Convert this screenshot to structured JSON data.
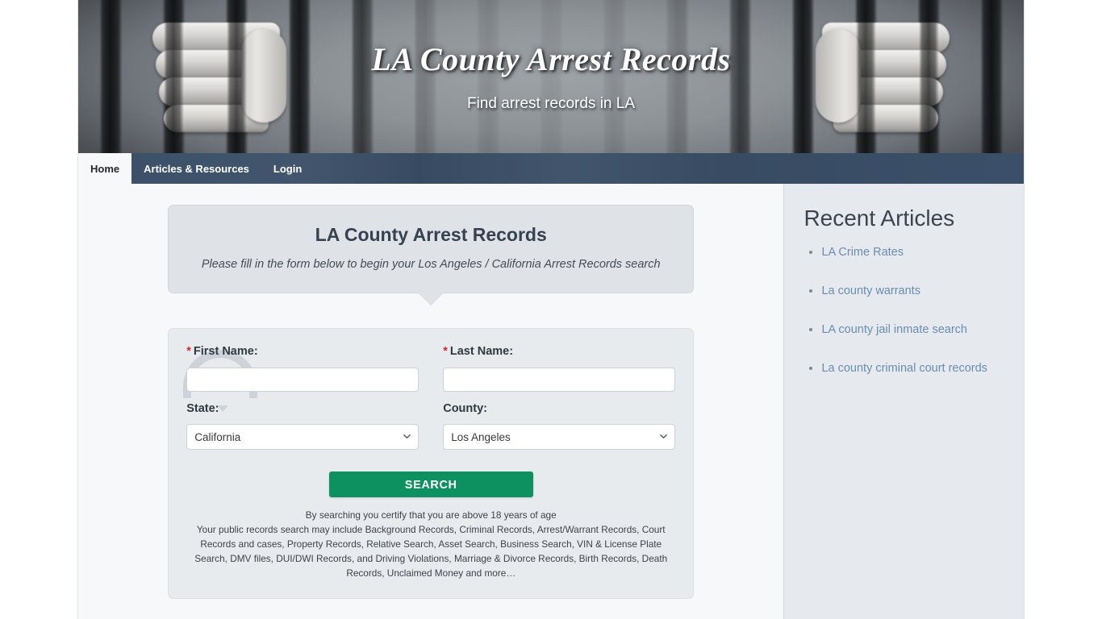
{
  "banner": {
    "title": "LA County Arrest Records",
    "subtitle": "Find arrest records in LA",
    "image_alt": "hands-gripping-jail-bars-photo"
  },
  "nav": {
    "items": [
      {
        "label": "Home",
        "active": true
      },
      {
        "label": "Articles & Resources",
        "active": false
      },
      {
        "label": "Login",
        "active": false
      }
    ]
  },
  "callout": {
    "title": "LA County Arrest Records",
    "subtitle": "Please fill in the form below to begin your Los Angeles / California Arrest Records search"
  },
  "form": {
    "first_name": {
      "label": "First Name:",
      "required_marker": "*",
      "value": "",
      "placeholder": ""
    },
    "last_name": {
      "label": "Last Name:",
      "required_marker": "*",
      "value": "",
      "placeholder": ""
    },
    "state": {
      "label": "State:",
      "selected": "California",
      "options": [
        "California"
      ]
    },
    "county": {
      "label": "County:",
      "selected": "Los Angeles",
      "options": [
        "Los Angeles"
      ]
    },
    "search_button": "SEARCH",
    "disclaimer_line1": "By searching you certify that you are above 18 years of age",
    "disclaimer_body": "Your public records search may include Background Records, Criminal Records, Arrest/Warrant Records, Court Records and cases, Property Records, Relative Search, Asset Search, Business Search, VIN & License Plate Search, DMV files, DUI/DWI Records, and Driving Violations, Marriage & Divorce Records, Birth Records, Death Records, Unclaimed Money and more…"
  },
  "sidebar": {
    "title": "Recent Articles",
    "links": [
      {
        "label": "LA Crime Rates"
      },
      {
        "label": "La county warrants"
      },
      {
        "label": "LA county jail inmate search"
      },
      {
        "label": "La county criminal court records"
      }
    ]
  },
  "colors": {
    "nav_bar": "#3b4f68",
    "search_button": "#0d9160",
    "required_star": "#d9232d",
    "sidebar_bg": "#e6eaee",
    "link": "#6a8cb0",
    "callout_bg": "#dfe3e7",
    "form_bg": "#e8ebee",
    "content_bg": "#f7f8fa"
  }
}
